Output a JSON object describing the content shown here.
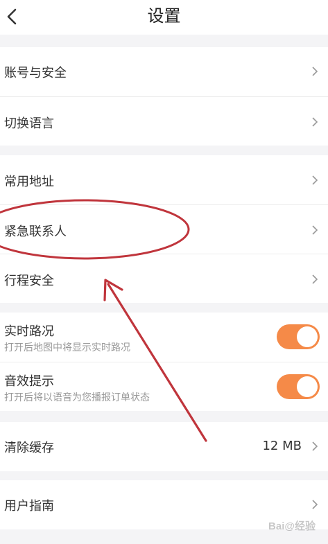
{
  "header": {
    "title": "设置"
  },
  "groups": [
    {
      "items": [
        {
          "label": "账号与安全"
        },
        {
          "label": "切换语言"
        }
      ]
    },
    {
      "items": [
        {
          "label": "常用地址"
        },
        {
          "label": "紧急联系人"
        },
        {
          "label": "行程安全"
        }
      ]
    },
    {
      "items": [
        {
          "label": "实时路况",
          "sub": "打开后地图中将显示实时路况",
          "toggle": true
        },
        {
          "label": "音效提示",
          "sub": "打开后将以语音为您播报订单状态",
          "toggle": true
        }
      ]
    },
    {
      "items": [
        {
          "label": "清除缓存",
          "value": "12 MB"
        }
      ]
    },
    {
      "items": [
        {
          "label": "用户指南"
        }
      ]
    }
  ],
  "colors": {
    "accent": "#f58a48",
    "annotation": "#c0353c"
  },
  "icons": {
    "back": "chevron-left-icon",
    "row": "chevron-right-icon"
  },
  "watermark": "Bai@经验"
}
